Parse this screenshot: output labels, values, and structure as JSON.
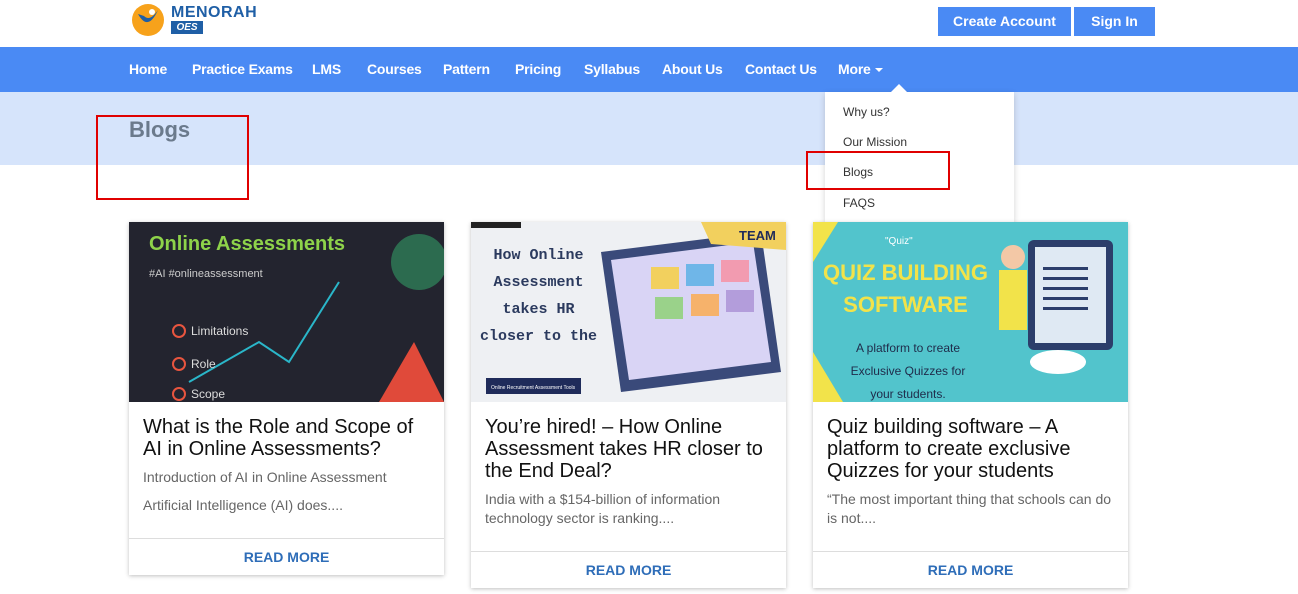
{
  "header": {
    "logo_title": "MENORAH",
    "logo_sub": "OES",
    "create_account": "Create Account",
    "sign_in": "Sign In"
  },
  "nav": {
    "items": [
      "Home",
      "Practice Exams",
      "LMS",
      "Courses",
      "Pattern",
      "Pricing",
      "Syllabus",
      "About Us",
      "Contact Us",
      "More"
    ]
  },
  "dropdown": {
    "items": [
      "Why us?",
      "Our Mission",
      "Blogs",
      "FAQS"
    ]
  },
  "banner": {
    "title": "Blogs"
  },
  "cards": [
    {
      "image_text": [
        "Online Assessments",
        "#AI #onlineassessment",
        "Limitations",
        "Role",
        "Scope"
      ],
      "title": "What is the Role and Scope of AI in Online Assessments?",
      "desc1": "Introduction of AI in Online Assessment",
      "desc2": "Artificial Intelligence (AI) does....",
      "read_more": "READ MORE"
    },
    {
      "image_text": [
        "How Online Assessment takes HR closer to the End Deal?",
        "TEAM",
        "Online Recruitment Assessment Tools"
      ],
      "title": "You’re hired! – How Online Assessment takes HR closer to the End Deal?",
      "desc1": "India with a $154-billion of information technology sector is ranking....",
      "read_more": "READ MORE"
    },
    {
      "image_text": [
        "\"Quiz\"",
        "QUIZ BUILDING SOFTWARE",
        "A platform to create Exclusive Quizzes for your students."
      ],
      "title": "Quiz building software – A platform to create exclusive Quizzes for your students",
      "desc1": "“The most important thing that schools can do is not....",
      "read_more": "READ MORE"
    }
  ],
  "colors": {
    "primary": "#4a8af4",
    "banner_bg": "#d6e4fb",
    "highlight": "#e00000",
    "link": "#2e6db8"
  }
}
